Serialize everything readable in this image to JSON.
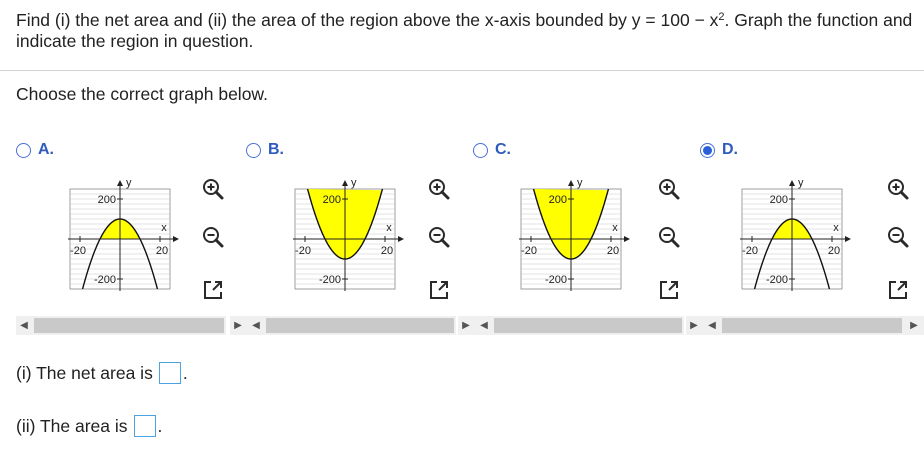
{
  "question": {
    "part1": "Find (i) the net area and (ii) the area of the region above the x-axis bounded by y = 100 − x",
    "exponent": "2",
    "part2": ". Graph the function and indicate the region in question."
  },
  "prompt": "Choose the correct graph below.",
  "options": [
    {
      "letter": "A.",
      "selected": false,
      "shade": "above-axis"
    },
    {
      "letter": "B.",
      "selected": false,
      "shade": "between-curve-and-top"
    },
    {
      "letter": "C.",
      "selected": false,
      "shade": "between-curve-and-top"
    },
    {
      "letter": "D.",
      "selected": true,
      "shade": "above-axis"
    }
  ],
  "graph": {
    "ylabel": "y",
    "xlabel": "x",
    "tick_labels": {
      "y_top": "200",
      "y_bottom": "-200",
      "x_left": "-20",
      "x_right": "20"
    }
  },
  "tools": [
    "zoom-in-icon",
    "zoom-out-icon",
    "popout-icon"
  ],
  "answers": {
    "net_area_label": "(i) The net area is",
    "area_label": "(ii) The area is",
    "suffix": "."
  },
  "colors": {
    "shade": "#ffff00",
    "accent": "#2e5bbd",
    "input_border": "#4aa3e0"
  },
  "chart_data": [
    {
      "type": "line",
      "title": "",
      "function": "y = 100 - x^2",
      "xlim": [
        -25,
        25
      ],
      "ylim": [
        -250,
        250
      ],
      "xticks": [
        -20,
        20
      ],
      "yticks": [
        -200,
        200
      ],
      "grid": true,
      "shaded_region": "between curve and x-axis",
      "series": [
        {
          "x": [
            -20,
            -15,
            -10,
            -5,
            0,
            5,
            10,
            15,
            20
          ],
          "y": [
            -300,
            -125,
            0,
            75,
            100,
            75,
            0,
            -125,
            -300
          ]
        }
      ]
    },
    {
      "type": "line",
      "title": "",
      "function": "y = x^2 - 100",
      "xlim": [
        -25,
        25
      ],
      "ylim": [
        -250,
        250
      ],
      "xticks": [
        -20,
        20
      ],
      "yticks": [
        -200,
        200
      ],
      "grid": true,
      "shaded_region": "between curve and top of plot",
      "series": [
        {
          "x": [
            -20,
            -15,
            -10,
            -5,
            0,
            5,
            10,
            15,
            20
          ],
          "y": [
            300,
            125,
            0,
            -75,
            -100,
            -75,
            0,
            125,
            300
          ]
        }
      ]
    },
    {
      "type": "line",
      "title": "",
      "function": "y = x^2 - 100",
      "xlim": [
        -25,
        25
      ],
      "ylim": [
        -250,
        250
      ],
      "xticks": [
        -20,
        20
      ],
      "yticks": [
        -200,
        200
      ],
      "grid": true,
      "shaded_region": "between curve and top of plot",
      "series": [
        {
          "x": [
            -20,
            -15,
            -10,
            -5,
            0,
            5,
            10,
            15,
            20
          ],
          "y": [
            300,
            125,
            0,
            -75,
            -100,
            -75,
            0,
            125,
            300
          ]
        }
      ]
    },
    {
      "type": "line",
      "title": "",
      "function": "y = 100 - x^2",
      "xlim": [
        -25,
        25
      ],
      "ylim": [
        -250,
        250
      ],
      "xticks": [
        -20,
        20
      ],
      "yticks": [
        -200,
        200
      ],
      "grid": true,
      "shaded_region": "between curve and x-axis",
      "series": [
        {
          "x": [
            -20,
            -15,
            -10,
            -5,
            0,
            5,
            10,
            15,
            20
          ],
          "y": [
            -300,
            -125,
            0,
            75,
            100,
            75,
            0,
            -125,
            -300
          ]
        }
      ]
    }
  ]
}
